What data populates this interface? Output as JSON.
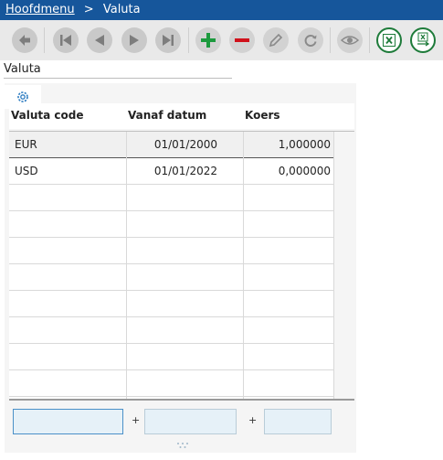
{
  "breadcrumb": {
    "home": "Hoofdmenu",
    "separator": ">",
    "current": "Valuta"
  },
  "toolbar": {
    "buttons": [
      {
        "name": "back",
        "icon": "arrow-left-icon"
      },
      {
        "name": "first",
        "icon": "first-record-icon"
      },
      {
        "name": "previous",
        "icon": "previous-record-icon"
      },
      {
        "name": "next",
        "icon": "next-record-icon"
      },
      {
        "name": "last",
        "icon": "last-record-icon"
      },
      {
        "name": "add",
        "icon": "plus-icon"
      },
      {
        "name": "delete",
        "icon": "minus-icon"
      },
      {
        "name": "edit",
        "icon": "pencil-icon"
      },
      {
        "name": "refresh",
        "icon": "refresh-icon"
      },
      {
        "name": "view",
        "icon": "eye-icon"
      },
      {
        "name": "export-excel",
        "icon": "excel-icon"
      },
      {
        "name": "import-excel",
        "icon": "excel-import-icon"
      }
    ],
    "colors": {
      "add": "#1c9a3e",
      "delete": "#d0111b",
      "excel": "#1e7b3a",
      "gray": "#8a8a8a"
    }
  },
  "page": {
    "title": "Valuta"
  },
  "grid": {
    "settings_icon": "gear-icon",
    "columns": [
      "Valuta code",
      "Vanaf datum",
      "Koers"
    ],
    "rows": [
      {
        "code": "EUR",
        "date": "01/01/2000",
        "rate": "1,000000",
        "selected": true
      },
      {
        "code": "USD",
        "date": "01/01/2022",
        "rate": "0,000000",
        "selected": false
      }
    ],
    "empty_rows": 8
  },
  "footer": {
    "sum_values": [
      "",
      "",
      ""
    ],
    "operators": [
      "+",
      "+"
    ]
  },
  "colors": {
    "header_bar": "#16569b",
    "toolbar_bg": "#e9e9e9",
    "sum_field": "#e6f1f8"
  }
}
